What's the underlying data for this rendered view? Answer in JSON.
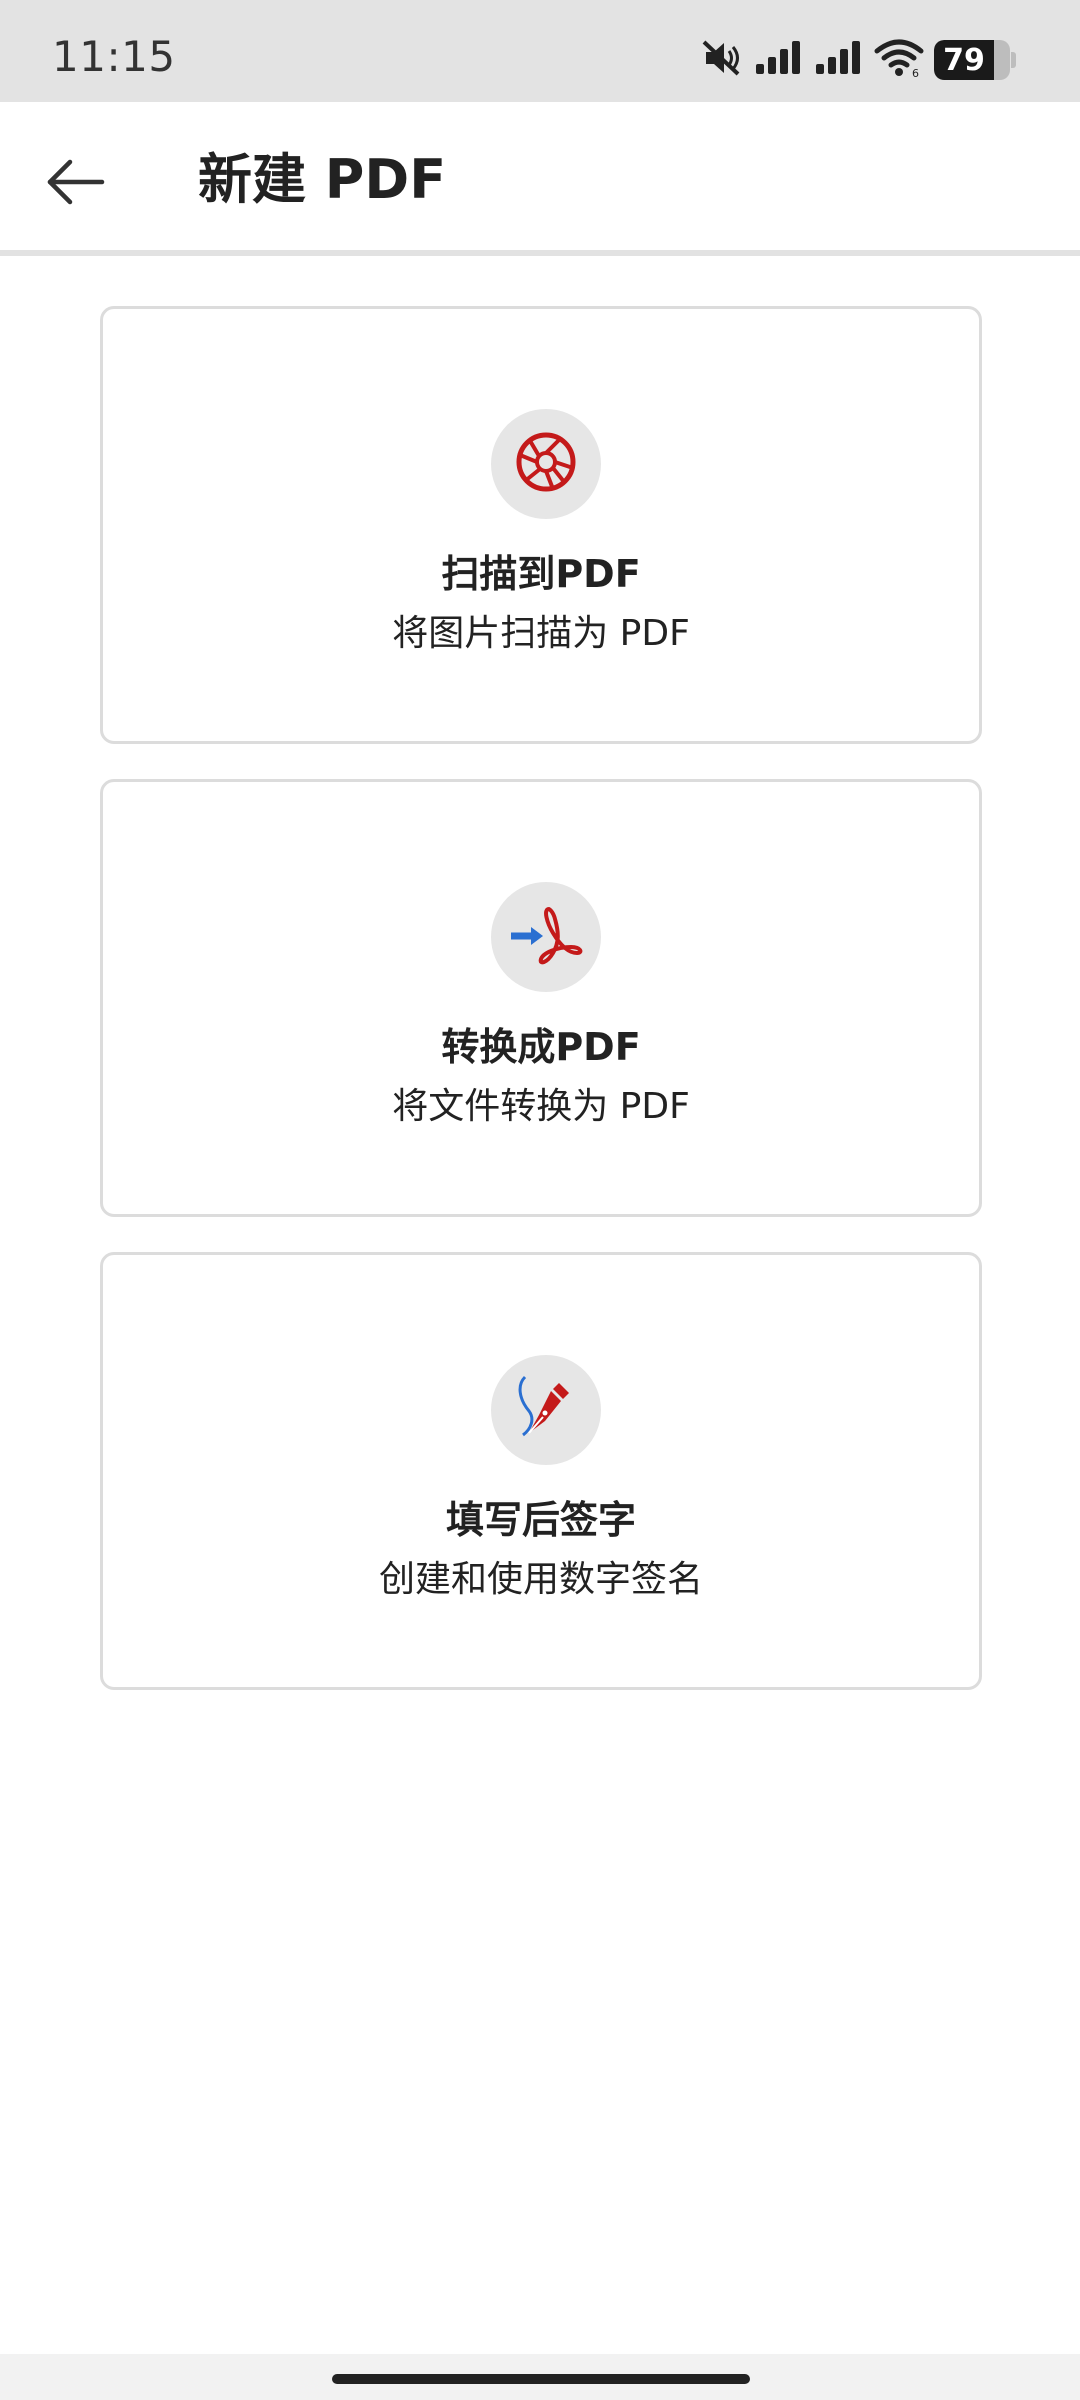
{
  "status_bar": {
    "time": "11:15",
    "battery_level": "79",
    "battery_fraction": 0.79,
    "icons": [
      "mute-icon",
      "signal-icon",
      "signal-icon",
      "wifi-icon",
      "battery-icon"
    ]
  },
  "header": {
    "title": "新建 PDF",
    "back_icon": "arrow-left-icon"
  },
  "cards": [
    {
      "title": "扫描到PDF",
      "description": "将图片扫描为 PDF",
      "icon": "camera-shutter-icon"
    },
    {
      "title": "转换成PDF",
      "description": "将文件转换为 PDF",
      "icon": "convert-pdf-icon"
    },
    {
      "title": "填写后签字",
      "description": "创建和使用数字签名",
      "icon": "pen-sign-icon"
    }
  ],
  "colors": {
    "accent_red": "#c41a1a",
    "accent_blue": "#2a6fd1",
    "icon_bg": "#e6e6e6",
    "card_border": "#dcdcdc"
  }
}
